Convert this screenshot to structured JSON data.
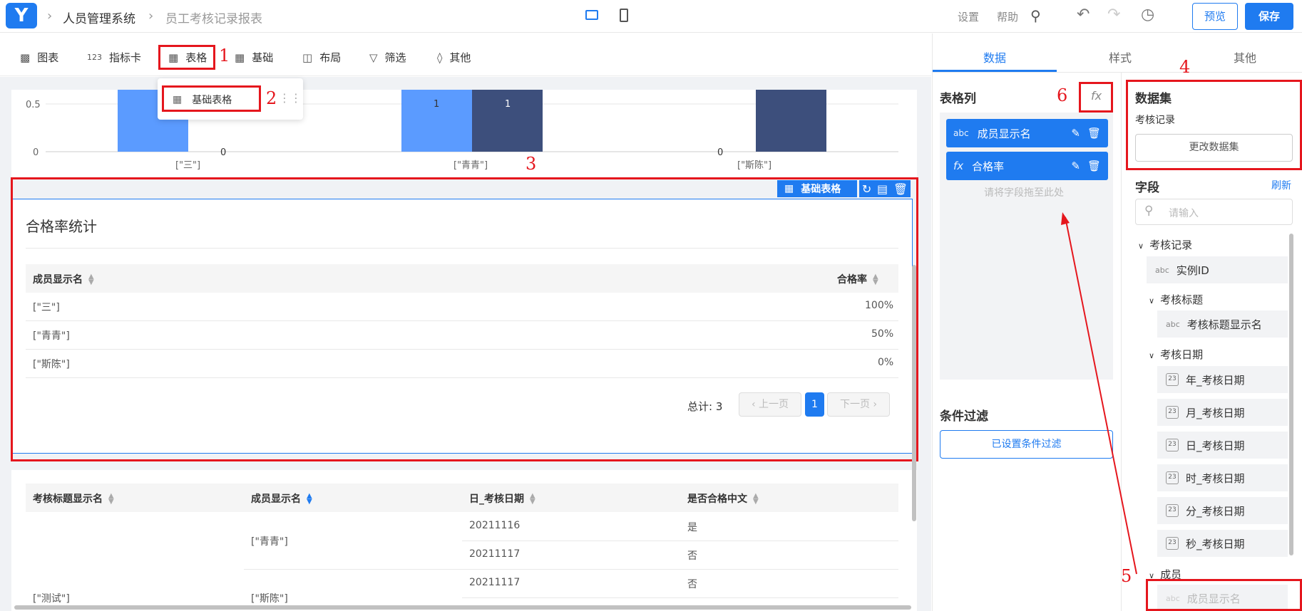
{
  "topbar": {
    "breadcrumb": [
      "人员管理系统",
      "员工考核记录报表"
    ],
    "settings": "设置",
    "help": "帮助",
    "preview": "预览",
    "save": "保存"
  },
  "toolbar": {
    "items": [
      "图表",
      "指标卡",
      "表格",
      "基础",
      "布局",
      "筛选",
      "其他"
    ],
    "dropdown_item": "基础表格",
    "icon_123": "123"
  },
  "annotations": [
    "1",
    "2",
    "3",
    "4",
    "5",
    "6"
  ],
  "bar_chart": {
    "y_ticks": [
      "0.5",
      "0"
    ],
    "categories": [
      "[\"三\"]",
      "[\"青青\"]",
      "[\"斯陈\"]"
    ],
    "labels": [
      "0",
      "1",
      "1",
      "0"
    ]
  },
  "widget_toolbar": {
    "label": "基础表格"
  },
  "table1": {
    "title": "合格率统计",
    "headers": [
      "成员显示名",
      "合格率"
    ],
    "rows": [
      [
        "[\"三\"]",
        "100%"
      ],
      [
        "[\"青青\"]",
        "50%"
      ],
      [
        "[\"斯陈\"]",
        "0%"
      ]
    ],
    "total": "总计: 3",
    "prev": "上一页",
    "next": "下一页",
    "page": "1"
  },
  "table2": {
    "headers": [
      "考核标题显示名",
      "成员显示名",
      "日_考核日期",
      "是否合格中文"
    ],
    "col1": "[\"测试\"]",
    "member1": "[\"青青\"]",
    "member2": "[\"斯陈\"]",
    "dates": [
      "20211116",
      "20211117",
      "20211117"
    ],
    "pass": [
      "是",
      "否",
      "否"
    ]
  },
  "right_tabs": [
    "数据",
    "样式",
    "其他"
  ],
  "table_columns": {
    "title": "表格列",
    "fx": "fx",
    "items": [
      {
        "type": "abc",
        "name": "成员显示名"
      },
      {
        "type": "fx",
        "name": "合格率"
      }
    ],
    "drop_hint": "请将字段拖至此处"
  },
  "filter": {
    "title": "条件过滤",
    "button": "已设置条件过滤"
  },
  "dataset": {
    "title": "数据集",
    "name": "考核记录",
    "change_button": "更改数据集"
  },
  "fields": {
    "title": "字段",
    "refresh": "刷新",
    "search_placeholder": "请输入",
    "root": "考核记录",
    "instance_id": "实例ID",
    "group_title": "考核标题",
    "title_display": "考核标题显示名",
    "group_date": "考核日期",
    "date_fields": [
      "年_考核日期",
      "月_考核日期",
      "日_考核日期",
      "时_考核日期",
      "分_考核日期",
      "秒_考核日期"
    ],
    "group_member": "成员",
    "member_display": "成员显示名",
    "abc": "abc",
    "cal_icon": "23"
  }
}
